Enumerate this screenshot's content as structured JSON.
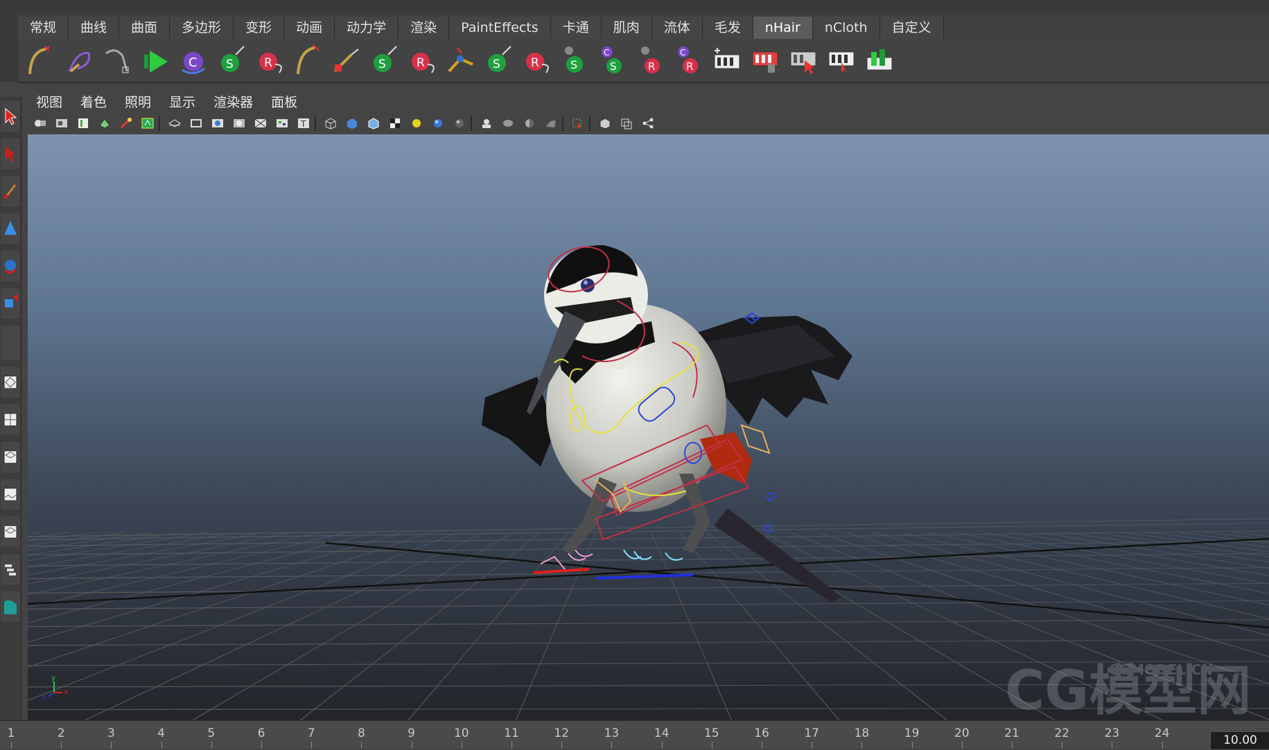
{
  "menu_tabs": [
    {
      "label": "常规"
    },
    {
      "label": "曲线"
    },
    {
      "label": "曲面"
    },
    {
      "label": "多边形"
    },
    {
      "label": "变形"
    },
    {
      "label": "动画"
    },
    {
      "label": "动力学"
    },
    {
      "label": "渲染"
    },
    {
      "label": "PaintEffects"
    },
    {
      "label": "卡通"
    },
    {
      "label": "肌肉"
    },
    {
      "label": "流体"
    },
    {
      "label": "毛发"
    },
    {
      "label": "nHair",
      "active": true
    },
    {
      "label": "nCloth"
    },
    {
      "label": "自定义"
    }
  ],
  "panel_menu": [
    {
      "label": "视图"
    },
    {
      "label": "着色"
    },
    {
      "label": "照明"
    },
    {
      "label": "显示"
    },
    {
      "label": "渲染器"
    },
    {
      "label": "面板"
    }
  ],
  "shelf_icons": [
    "hair-curve-icon",
    "brush-curve-icon",
    "rope-curve-icon",
    "play-green-icon",
    "c-purple-icon",
    "s-green-icon",
    "r-red-icon",
    "hair-tool-icon",
    "paint-hair-icon",
    "s-green-icon",
    "r-red-icon",
    "joint-icon",
    "s-green-icon",
    "r-red-icon",
    "s-grey-icon",
    "cs-icon",
    "r-grey-icon",
    "cr-icon",
    "film-plus-icon",
    "film-delete-icon",
    "film-select-icon",
    "film-edit-icon",
    "film-green-icon"
  ],
  "timeline": {
    "ticks": [
      "1",
      "2",
      "3",
      "4",
      "5",
      "6",
      "7",
      "8",
      "9",
      "10",
      "11",
      "12",
      "13",
      "14",
      "15",
      "16",
      "17",
      "18",
      "19",
      "20",
      "21",
      "22",
      "23",
      "24"
    ],
    "current_frame": "10.00"
  },
  "watermark": {
    "text": "CG模型网",
    "subtext": "CGMODEL.CN"
  },
  "colors": {
    "accent": "#5b5b5b",
    "viewport_top": "#7e94ae",
    "viewport_bottom": "#23252a"
  }
}
